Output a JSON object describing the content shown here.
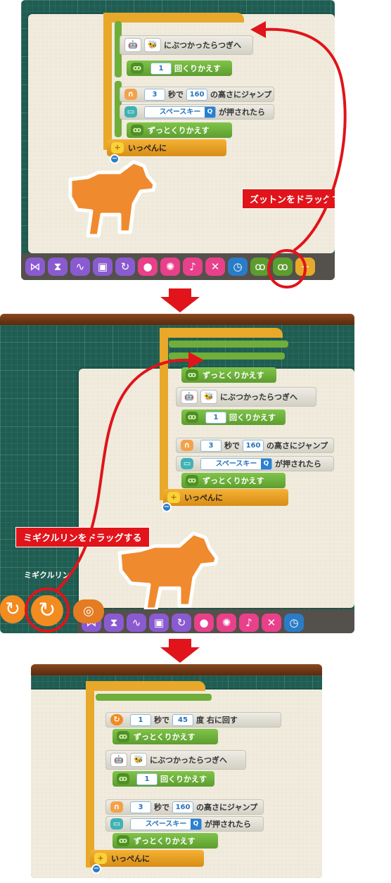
{
  "steps": [
    {
      "callout": "ズットンをドラッグする",
      "blocks": {
        "collide": "にぶつかったらつぎへ",
        "repeat_count": "1",
        "repeat_label": "回くりかえす",
        "jump_seconds": "3",
        "jump_sec_label": "秒で",
        "jump_height": "160",
        "jump_label": "の高さにジャンプ",
        "key_name": "スペースキー",
        "key_label": "が押されたら",
        "forever": "ずっとくりかえす",
        "together": "いっぺんに"
      }
    },
    {
      "callout": "ミギクルリンをドラッグする",
      "palette_caption": "ミギクルリン",
      "blocks": {
        "forever_top": "ずっとくりかえす",
        "collide": "にぶつかったらつぎへ",
        "repeat_count": "1",
        "repeat_label": "回くりかえす",
        "jump_seconds": "3",
        "jump_sec_label": "秒で",
        "jump_height": "160",
        "jump_label": "の高さにジャンプ",
        "key_name": "スペースキー",
        "key_label": "が押されたら",
        "forever": "ずっとくりかえす",
        "together": "いっぺんに"
      }
    },
    {
      "blocks": {
        "rotate_seconds": "1",
        "rotate_sec_label": "秒で",
        "rotate_degrees": "45",
        "rotate_label": "度 右に回す",
        "forever_top": "ずっとくりかえす",
        "collide": "にぶつかったらつぎへ",
        "repeat_count": "1",
        "repeat_label": "回くりかえす",
        "jump_seconds": "3",
        "jump_sec_label": "秒で",
        "jump_height": "160",
        "jump_label": "の高さにジャンプ",
        "key_name": "スペースキー",
        "key_label": "が押されたら",
        "forever": "ずっとくりかえす",
        "together": "いっぺんに"
      }
    }
  ],
  "icons": {
    "loop": "ꝏ",
    "search": "Q",
    "minus": "−",
    "plus": "+"
  },
  "colors": {
    "callout_red": "#e0141a",
    "block_green": "#6fae3a",
    "bracket_orange": "#e8a82a",
    "grid_green": "#1f5d52",
    "dog_orange": "#f08a2e"
  }
}
